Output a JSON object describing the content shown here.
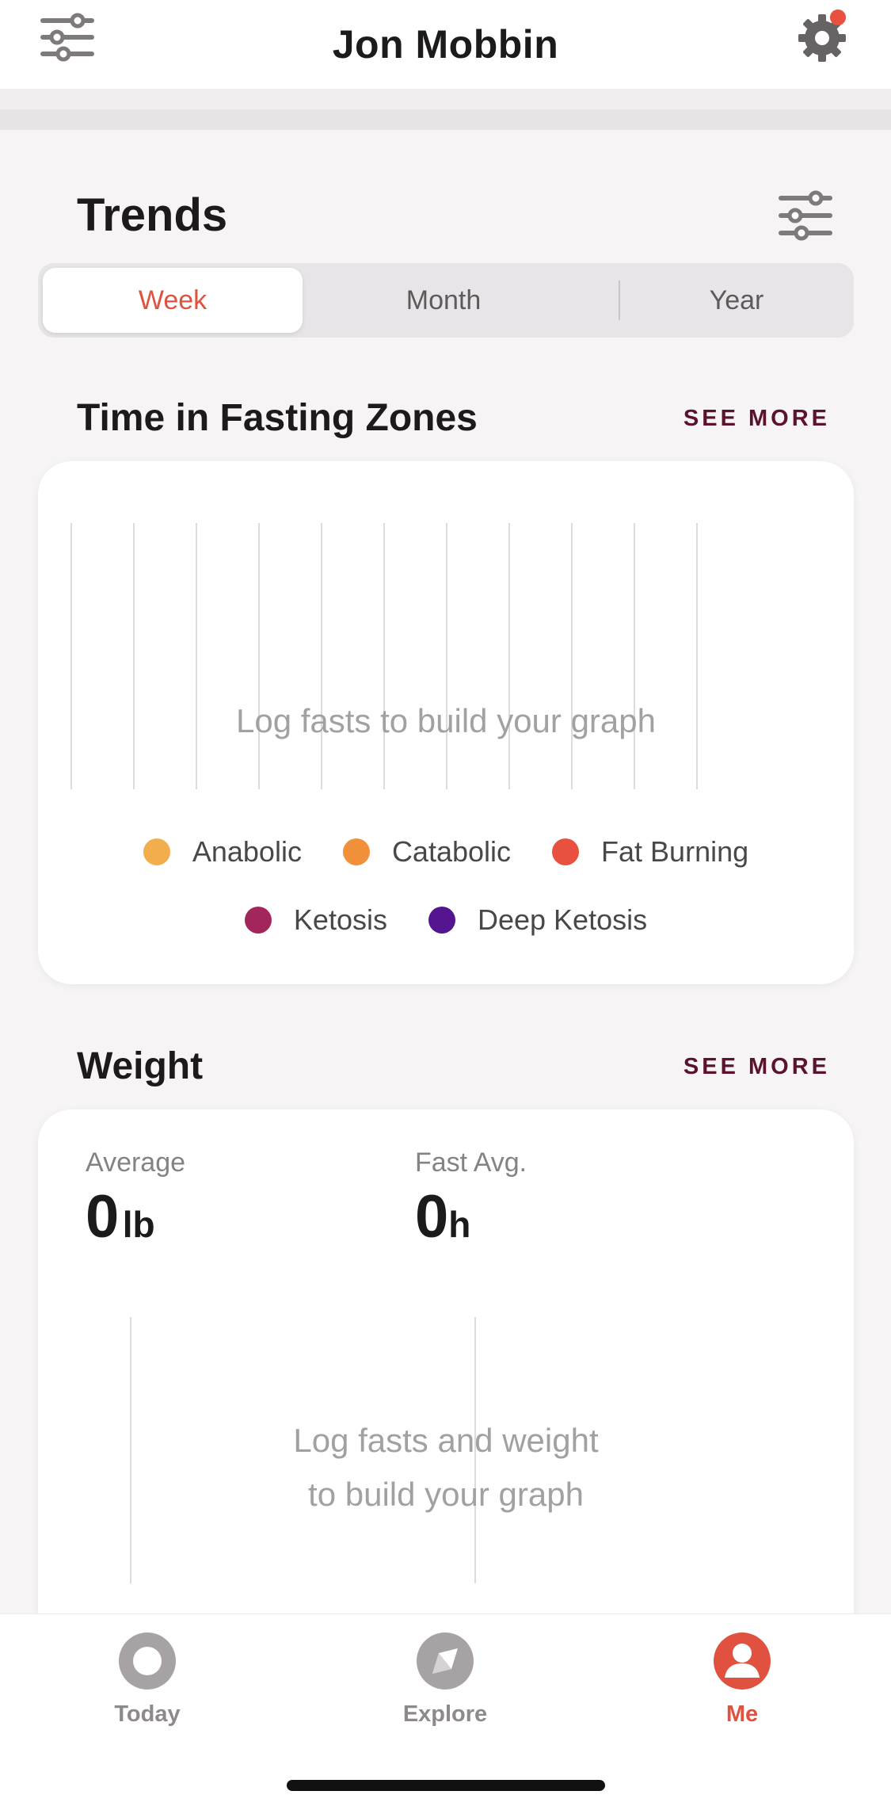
{
  "header": {
    "title": "Jon Mobbin",
    "filter_icon": "sliders-icon",
    "settings_icon": "gear-icon",
    "notification_color": "#e8513f"
  },
  "trends": {
    "title": "Trends",
    "filter_icon": "sliders-icon",
    "tabs": [
      {
        "label": "Week",
        "active": true
      },
      {
        "label": "Month",
        "active": false
      },
      {
        "label": "Year",
        "active": false
      }
    ]
  },
  "fasting_zones": {
    "title": "Time in Fasting Zones",
    "see_more": "SEE MORE",
    "empty_message": "Log fasts to build your graph",
    "legend": [
      {
        "label": "Anabolic",
        "color": "#f2ad4d"
      },
      {
        "label": "Catabolic",
        "color": "#f0913a"
      },
      {
        "label": "Fat Burning",
        "color": "#e8513f"
      },
      {
        "label": "Ketosis",
        "color": "#a3265a"
      },
      {
        "label": "Deep Ketosis",
        "color": "#561590"
      }
    ]
  },
  "weight": {
    "title": "Weight",
    "see_more": "SEE MORE",
    "average": {
      "label": "Average",
      "value": "0",
      "unit": "lb"
    },
    "fast_avg": {
      "label": "Fast Avg.",
      "value": "0",
      "unit": "h"
    },
    "empty_message_line1": "Log fasts and weight",
    "empty_message_line2": "to build your graph"
  },
  "tabbar": {
    "items": [
      {
        "label": "Today",
        "icon": "today-ring-icon",
        "active": false
      },
      {
        "label": "Explore",
        "icon": "compass-icon",
        "active": false
      },
      {
        "label": "Me",
        "icon": "profile-icon",
        "active": true
      }
    ]
  },
  "colors": {
    "accent": "#e0523f",
    "see_more": "#5a1230"
  }
}
